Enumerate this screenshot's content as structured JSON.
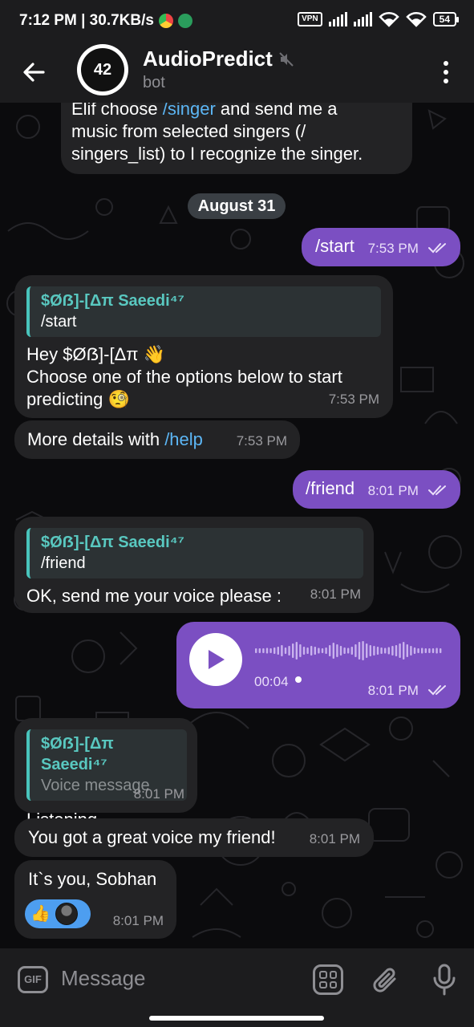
{
  "status_bar": {
    "left_text": "7:12 PM | 30.7KB/s",
    "vpn": "VPN",
    "battery": "54"
  },
  "header": {
    "title": "AudioPredict",
    "subtitle": "bot",
    "avatar_text": "42"
  },
  "messages": {
    "m1": {
      "line1_pre": "Elif choose ",
      "line1_link": "/singer",
      "line1_post": " and send me a",
      "line2": "music from selected singers (/",
      "line3": "singers_list) to I recognize the singer."
    },
    "date_divider": "August 31",
    "m2": {
      "text": "/start",
      "time": "7:53 PM"
    },
    "m3": {
      "quote_name": "$Øẞ]-[Δπ Saeedi⁴⁷",
      "quote_text": "/start",
      "line1": "Hey $Øẞ]-[Δπ 👋",
      "line2": "Choose one of the options below to start",
      "line3": "predicting 🧐",
      "time": "7:53 PM"
    },
    "m4": {
      "text_pre": "More details with ",
      "link": "/help",
      "time": "7:53 PM"
    },
    "m5": {
      "text": "/friend",
      "time": "8:01 PM"
    },
    "m6": {
      "quote_name": "$Øẞ]-[Δπ Saeedi⁴⁷",
      "quote_text": "/friend",
      "text": "OK, send me your voice please :",
      "time": "8:01 PM"
    },
    "m7": {
      "duration": "00:04",
      "time": "8:01 PM"
    },
    "m8": {
      "quote_name": "$Øẞ]-[Δπ Saeedi⁴⁷",
      "quote_text": "Voice message",
      "text": "Listening...",
      "time": "8:01 PM"
    },
    "m9": {
      "text": "You got a great voice my friend!",
      "time": "8:01 PM"
    },
    "m10": {
      "text": "It`s you, Sobhan",
      "reaction": "👍",
      "time": "8:01 PM"
    }
  },
  "input_bar": {
    "gif_label": "GIF",
    "placeholder": "Message"
  },
  "colors": {
    "outgoing_bubble": "#7b4fc2",
    "incoming_bubble": "#232325",
    "link": "#5cb6f5",
    "quote_accent": "#49c4bc",
    "bar_background": "#1c1c1e"
  },
  "icons": {
    "back": "arrow-left-icon",
    "mute": "speaker-muted-icon",
    "menu": "more-vertical-icon",
    "play": "play-icon",
    "read": "double-check-icon",
    "gif": "gif-icon",
    "stickers": "stickers-icon",
    "attach": "paperclip-icon",
    "mic": "microphone-icon"
  }
}
